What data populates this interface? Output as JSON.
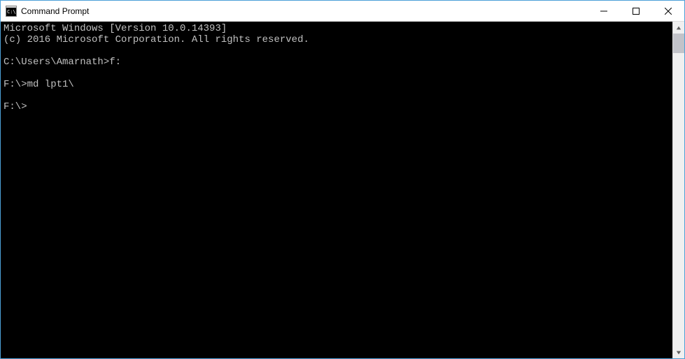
{
  "window": {
    "title": "Command Prompt"
  },
  "terminal": {
    "lines": [
      "Microsoft Windows [Version 10.0.14393]",
      "(c) 2016 Microsoft Corporation. All rights reserved.",
      "",
      "C:\\Users\\Amarnath>f:",
      "",
      "F:\\>md lpt1\\",
      "",
      "F:\\>"
    ]
  }
}
